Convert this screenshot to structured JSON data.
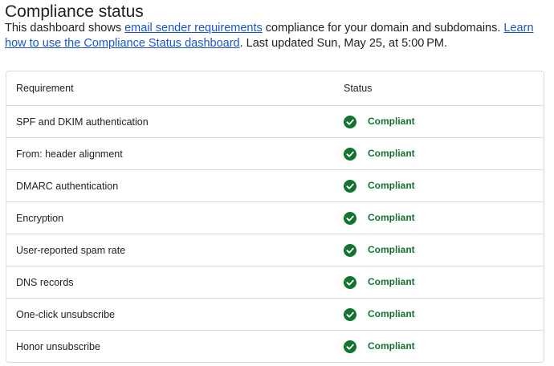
{
  "page": {
    "title": "Compliance status",
    "description": {
      "prefix": "This dashboard shows ",
      "link1": "email sender requirements",
      "middle": " compliance for your domain and subdomains. ",
      "link2": "Learn how to use the Compliance Status dashboard",
      "suffix": ". Last updated Sun, May 25, at 5:00 PM."
    }
  },
  "table": {
    "headers": {
      "requirement": "Requirement",
      "status": "Status"
    },
    "rows": [
      {
        "requirement": "SPF and DKIM authentication",
        "status": "Compliant",
        "icon": "check-circle-icon"
      },
      {
        "requirement": "From: header alignment",
        "status": "Compliant",
        "icon": "check-circle-icon"
      },
      {
        "requirement": "DMARC authentication",
        "status": "Compliant",
        "icon": "check-circle-icon"
      },
      {
        "requirement": "Encryption",
        "status": "Compliant",
        "icon": "check-circle-icon"
      },
      {
        "requirement": "User-reported spam rate",
        "status": "Compliant",
        "icon": "check-circle-icon"
      },
      {
        "requirement": "DNS records",
        "status": "Compliant",
        "icon": "check-circle-icon"
      },
      {
        "requirement": "One-click unsubscribe",
        "status": "Compliant",
        "icon": "check-circle-icon"
      },
      {
        "requirement": "Honor unsubscribe",
        "status": "Compliant",
        "icon": "check-circle-icon"
      }
    ]
  },
  "colors": {
    "compliant_green": "#137333",
    "link_blue": "#1a56c8",
    "border": "#dadce0",
    "text": "#202124"
  }
}
